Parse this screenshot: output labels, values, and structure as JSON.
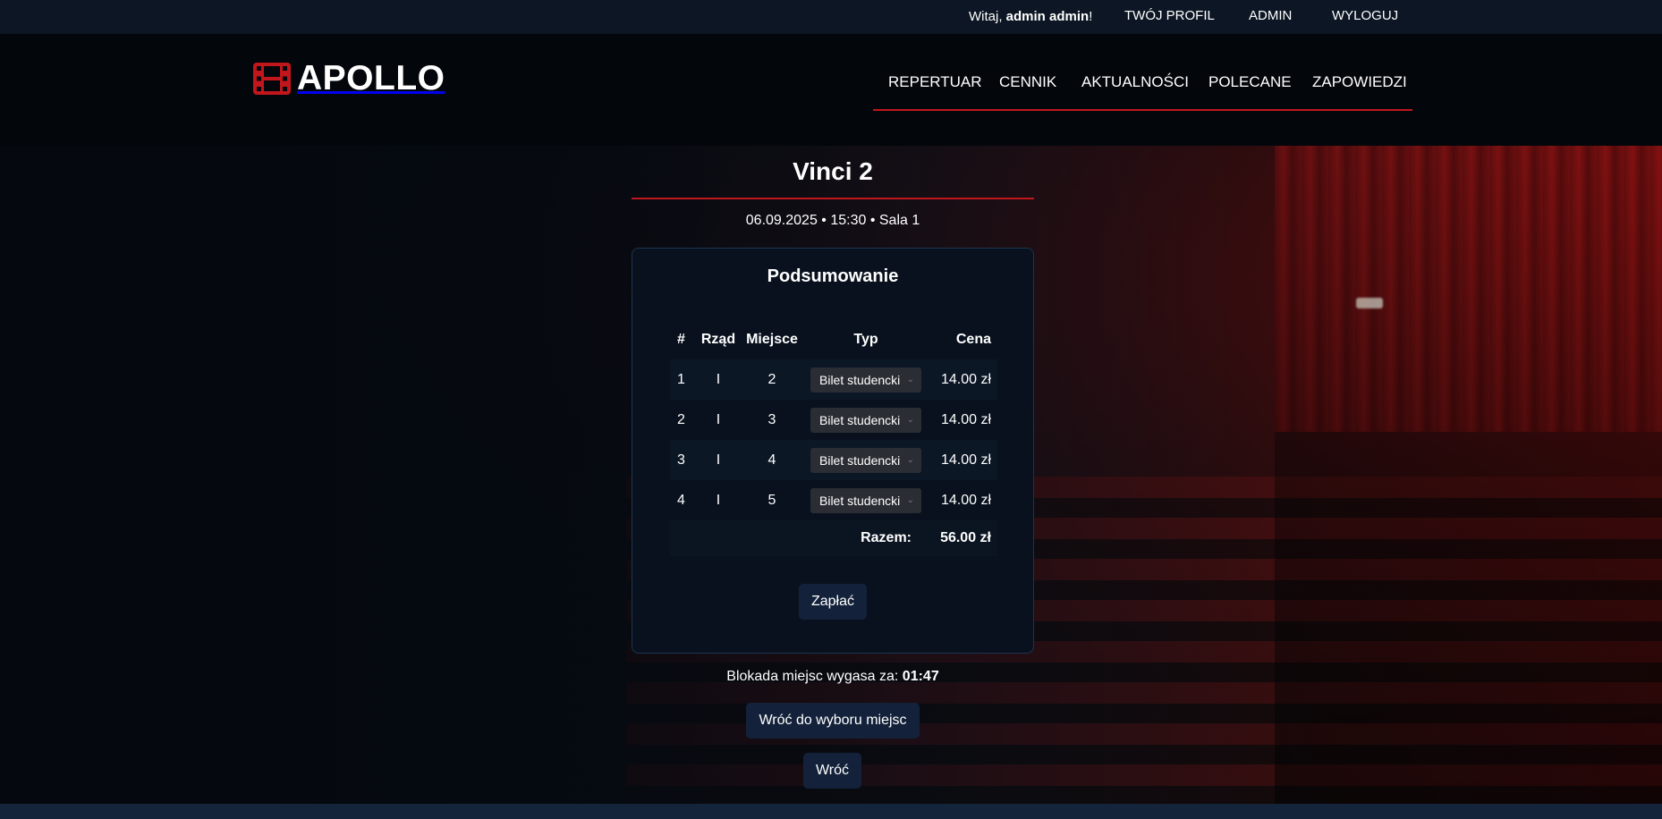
{
  "topbar": {
    "greeting_prefix": "Witaj, ",
    "user_name": "admin admin",
    "greeting_suffix": "!",
    "links": [
      "TWÓJ PROFIL",
      "ADMIN",
      "WYLOGUJ"
    ]
  },
  "header": {
    "logo_text": "APOLLO",
    "logo_icon": "film-icon",
    "nav": [
      "REPERTUAR",
      "CENNIK",
      "AKTUALNOŚCI",
      "POLECANE",
      "ZAPOWIEDZI"
    ]
  },
  "movie": {
    "title": "Vinci 2",
    "show_info": "06.09.2025 • 15:30 • Sala 1"
  },
  "summary": {
    "title": "Podsumowanie",
    "columns": [
      "#",
      "Rząd",
      "Miejsce",
      "Typ",
      "Cena"
    ],
    "rows": [
      {
        "num": "1",
        "row": "I",
        "seat": "2",
        "type": "Bilet studencki",
        "price": "14.00 zł"
      },
      {
        "num": "2",
        "row": "I",
        "seat": "3",
        "type": "Bilet studencki",
        "price": "14.00 zł"
      },
      {
        "num": "3",
        "row": "I",
        "seat": "4",
        "type": "Bilet studencki",
        "price": "14.00 zł"
      },
      {
        "num": "4",
        "row": "I",
        "seat": "5",
        "type": "Bilet studencki",
        "price": "14.00 zł"
      }
    ],
    "total_label": "Razem:",
    "total_value": "56.00 zł",
    "pay_label": "Zapłać"
  },
  "timer": {
    "label": "Blokada miejsc wygasa za: ",
    "value": "01:47"
  },
  "buttons": {
    "back_to_seats": "Wróć do wyboru miejsc",
    "back": "Wróć"
  },
  "colors": {
    "accent": "#c0161c",
    "background": "#050a12",
    "topbar": "#0c1624",
    "button": "#13223a"
  }
}
